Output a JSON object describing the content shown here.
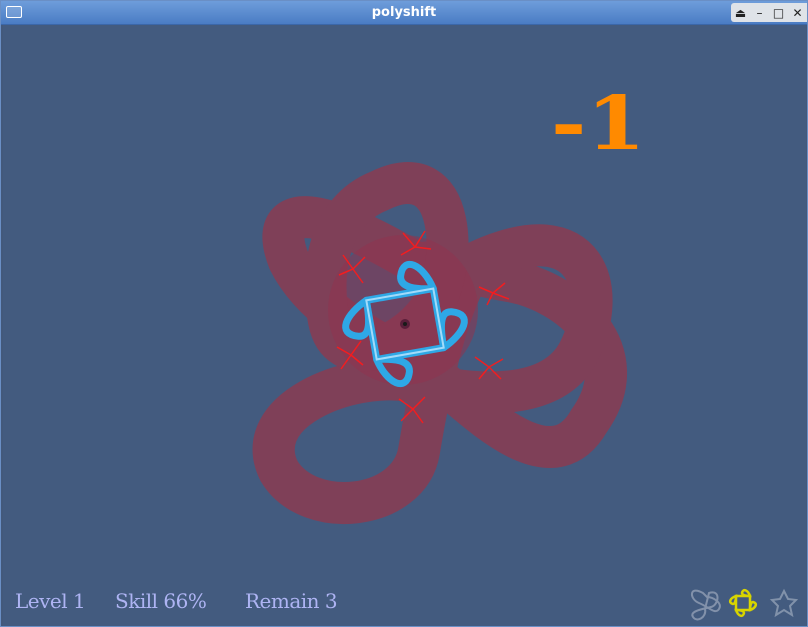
{
  "window": {
    "title": "polyshift"
  },
  "controls": [
    "eject-icon",
    "minimize-icon",
    "maximize-icon",
    "close-icon"
  ],
  "controls_glyphs": {
    "eject": "⏏",
    "minimize": "–",
    "maximize": "□",
    "close": "✕"
  },
  "score_popup": "-1",
  "hud": {
    "level": "Level 1",
    "skill": "Skill 66%",
    "remain": "Remain 3"
  },
  "colors": {
    "background": "#435b7f",
    "target_shape": "#b02a3a",
    "player_shape": "#2ea8e6",
    "score": "#ff8a00",
    "hud_text": "#aeb4f3"
  },
  "shape_selector": [
    "trefoil-shape-icon",
    "square-knot-shape-icon",
    "star-shape-icon"
  ],
  "selected_shape": "square-knot-shape-icon"
}
